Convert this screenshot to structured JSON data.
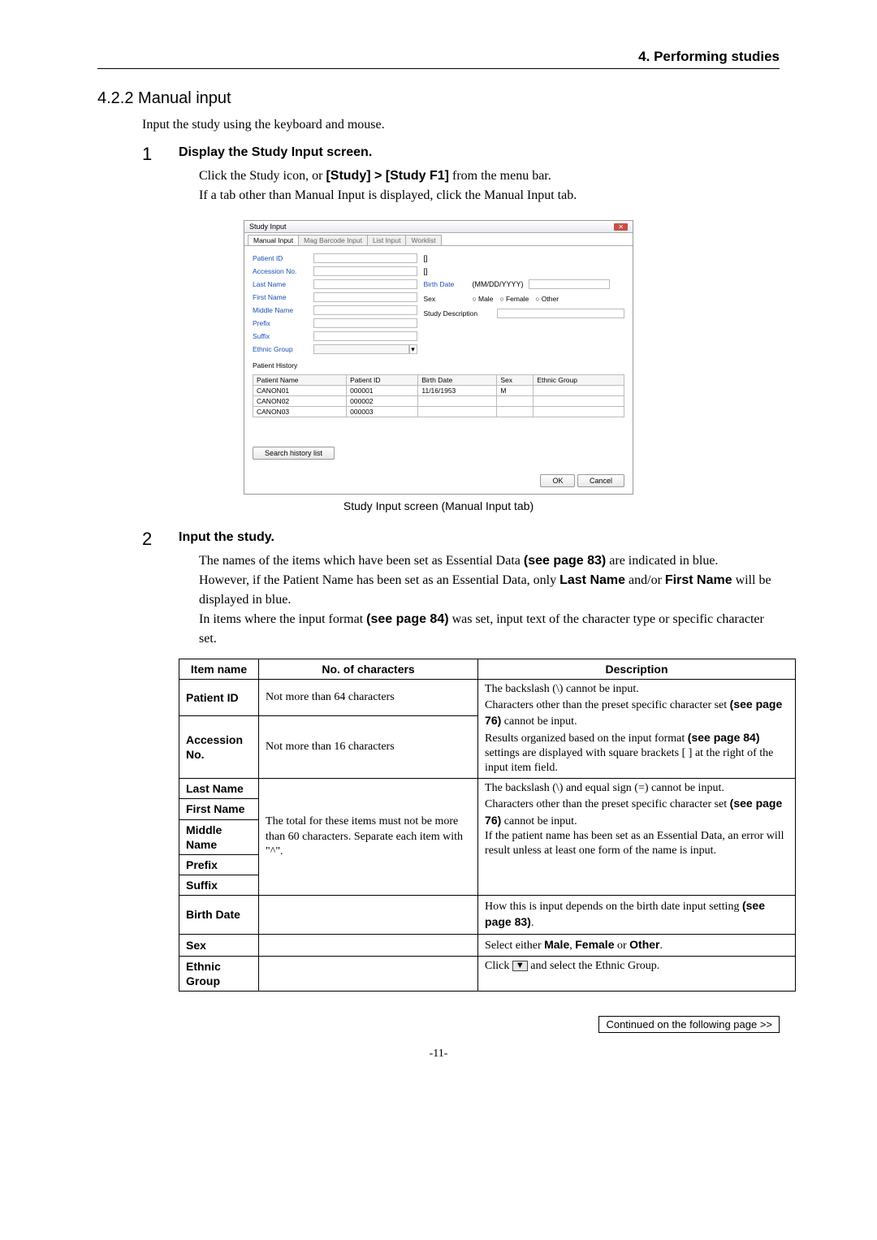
{
  "header": {
    "chapter": "4. Performing studies"
  },
  "section": {
    "number": "4.2.2",
    "title": "Manual input"
  },
  "intro": "Input the study using the keyboard and mouse.",
  "step1": {
    "num": "1",
    "title": "Display the Study Input screen.",
    "line1_a": "Click the Study icon, or ",
    "line1_b": "[Study] > [Study F1]",
    "line1_c": " from the menu bar.",
    "line2": "If a tab other than Manual Input is displayed, click the Manual Input tab."
  },
  "screenshot": {
    "title": "Study Input",
    "tabs": [
      "Manual Input",
      "Mag Barcode Input",
      "List Input",
      "Worklist"
    ],
    "form_labels": {
      "patient_id": "Patient ID",
      "accession_no": "Accession No.",
      "last_name": "Last Name",
      "first_name": "First Name",
      "middle_name": "Middle Name",
      "prefix": "Prefix",
      "suffix": "Suffix",
      "ethnic_group": "Ethnic Group",
      "birth_date": "Birth Date",
      "birth_date_fmt": "(MM/DD/YYYY)",
      "sex": "Sex",
      "male": "Male",
      "female": "Female",
      "other": "Other",
      "study_desc": "Study Description",
      "patient_history": "Patient History"
    },
    "history": {
      "headers": [
        "Patient Name",
        "Patient ID",
        "Birth Date",
        "Sex",
        "Ethnic Group"
      ],
      "rows": [
        [
          "CANON01",
          "000001",
          "11/16/1953",
          "M",
          ""
        ],
        [
          "CANON02",
          "000002",
          "",
          "",
          ""
        ],
        [
          "CANON03",
          "000003",
          "",
          "",
          ""
        ]
      ]
    },
    "search_btn": "Search history list",
    "ok": "OK",
    "cancel": "Cancel"
  },
  "caption": "Study Input screen (Manual Input tab)",
  "step2": {
    "num": "2",
    "title": "Input the study.",
    "p1_a": "The names of the items which have been set as Essential Data ",
    "p1_b": "(see page 83)",
    "p1_c": " are indicated in blue.",
    "p2_a": "However, if the Patient Name has been set as an Essential Data, only ",
    "p2_b": "Last Name",
    "p2_c": " and/or ",
    "p2_d": "First Name",
    "p2_e": " will be displayed in blue.",
    "p3_a": "In items where the input format ",
    "p3_b": "(see page 84)",
    "p3_c": " was set, input text of the character type or specific character set."
  },
  "table": {
    "headers": {
      "item": "Item name",
      "num": "No. of characters",
      "desc": "Description"
    },
    "patient_id": {
      "name": "Patient ID",
      "num": "Not more than 64 characters"
    },
    "accession": {
      "name": "Accession No.",
      "num": "Not more than 16 characters"
    },
    "last_name": {
      "name": "Last Name"
    },
    "first_name": {
      "name": "First Name"
    },
    "middle_name": {
      "name": "Middle Name"
    },
    "prefix": {
      "name": "Prefix"
    },
    "suffix": {
      "name": "Suffix"
    },
    "names_num": "The total for these items must not be more than 60 characters. Separate each item with \"^\".",
    "birth_date": {
      "name": "Birth Date"
    },
    "sex": {
      "name": "Sex"
    },
    "ethnic": {
      "name": "Ethnic Group"
    },
    "desc_block1_a": "The backslash (\\) cannot be input.",
    "desc_block1_b": "Characters other than the preset specific character set ",
    "desc_block1_c": "(see page 76)",
    "desc_block1_d": " cannot be input.",
    "desc_block1_e": "Results organized based on the input format ",
    "desc_block1_f": "(see page 84)",
    "desc_block1_g": " settings are displayed with square brackets [ ] at the right of the input item field.",
    "desc_names_a": "The backslash (\\) and equal sign (=) cannot be input.",
    "desc_names_b": "Characters other than the preset specific character set ",
    "desc_names_c": "(see page 76)",
    "desc_names_d": " cannot be input.",
    "desc_names_e": "If the patient name has been set as an Essential Data, an error will result unless at least one form of the name is input.",
    "desc_birth_a": "How this is input depends on the birth date input setting ",
    "desc_birth_b": "(see page 83)",
    "desc_birth_c": ".",
    "desc_sex_a": "Select either ",
    "desc_sex_b": "Male",
    "desc_sex_c": ", ",
    "desc_sex_d": "Female",
    "desc_sex_e": " or ",
    "desc_sex_f": "Other",
    "desc_sex_g": ".",
    "desc_ethnic_a": "Click ",
    "desc_ethnic_b": " and select the Ethnic Group."
  },
  "continued": "Continued on the following page >>",
  "page_num": "-11-"
}
